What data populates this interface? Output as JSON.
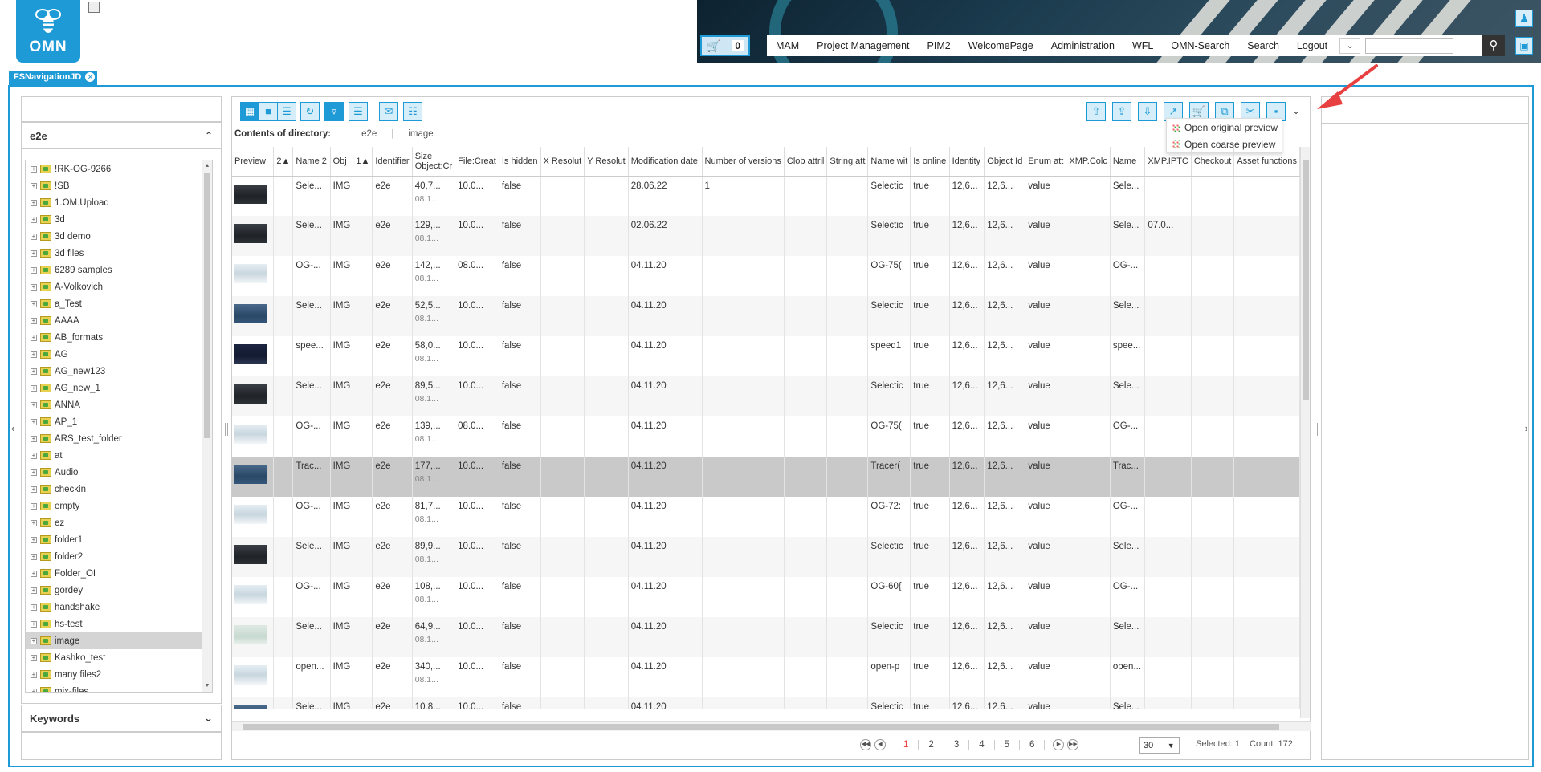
{
  "header": {
    "logo_text": "OMN",
    "cart_count": "0",
    "menu": [
      "MAM",
      "Project Management",
      "PIM2",
      "WelcomePage",
      "Administration",
      "WFL",
      "OMN-Search",
      "Search",
      "Logout"
    ],
    "search_placeholder": ""
  },
  "tab": {
    "label": "FSNavigationJD"
  },
  "left_panel": {
    "title": "e2e",
    "keywords_title": "Keywords",
    "tree": [
      "!RK-OG-9266",
      "!SB",
      "1.OM.Upload",
      "3d",
      "3d demo",
      "3d files",
      "6289 samples",
      "A-Volkovich",
      "a_Test",
      "AAAA",
      "AB_formats",
      "AG",
      "AG_new123",
      "AG_new_1",
      "ANNA",
      "AP_1",
      "ARS_test_folder",
      "at",
      "Audio",
      "checkin",
      "empty",
      "ez",
      "folder1",
      "folder2",
      "Folder_OI",
      "gordey",
      "handshake",
      "hs-test",
      "image",
      "Kashko_test",
      "many files2",
      "mix-files"
    ],
    "selected": "image"
  },
  "main": {
    "dir_label": "Contents of directory:",
    "breadcrumb": [
      "e2e",
      "image"
    ],
    "dropdown": [
      "Open original preview",
      "Open coarse preview"
    ],
    "columns": [
      "Preview",
      "2▲",
      "Name 2",
      "Obj",
      "1▲",
      "Identifier",
      "Size Object:Cr",
      "File:Creat",
      "Is hidden",
      "X Resolut",
      "Y Resolut",
      "Modification date",
      "Number of versions",
      "Clob attril",
      "String att",
      "Name wit",
      "Is online",
      "Identity",
      "Object Id",
      "Enum att",
      "XMP.Colc",
      "Name",
      "XMP.IPTC",
      "Checkout",
      "Asset functions"
    ],
    "rows": [
      {
        "name2": "Sele...",
        "obj": "IMG",
        "ident": "e2e",
        "size": "40,7...",
        "size2": "08.1...",
        "fcreat": "10.0...",
        "hidden": "false",
        "moddate": "28.06.22",
        "versions": "1",
        "namewit": "Selectic",
        "online": "true",
        "identity": "12,6...",
        "objid": "12,6...",
        "enum": "value",
        "name": "Sele...",
        "iptc": "",
        "thumb": "dark"
      },
      {
        "name2": "Sele...",
        "obj": "IMG",
        "ident": "e2e",
        "size": "129,...",
        "size2": "08.1...",
        "fcreat": "10.0...",
        "hidden": "false",
        "moddate": "02.06.22",
        "versions": "",
        "namewit": "Selectic",
        "online": "true",
        "identity": "12,6...",
        "objid": "12,6...",
        "enum": "value",
        "name": "Sele...",
        "iptc": "07.0...",
        "thumb": "dark"
      },
      {
        "name2": "OG-...",
        "obj": "IMG",
        "ident": "e2e",
        "size": "142,...",
        "size2": "08.1...",
        "fcreat": "08.0...",
        "hidden": "false",
        "moddate": "04.11.20",
        "versions": "",
        "namewit": "OG-75(",
        "online": "true",
        "identity": "12,6...",
        "objid": "12,6...",
        "enum": "value",
        "name": "OG-...",
        "iptc": "",
        "thumb": "light"
      },
      {
        "name2": "Sele...",
        "obj": "IMG",
        "ident": "e2e",
        "size": "52,5...",
        "size2": "08.1...",
        "fcreat": "10.0...",
        "hidden": "false",
        "moddate": "04.11.20",
        "versions": "",
        "namewit": "Selectic",
        "online": "true",
        "identity": "12,6...",
        "objid": "12,6...",
        "enum": "value",
        "name": "Sele...",
        "iptc": "",
        "thumb": "blue"
      },
      {
        "name2": "spee...",
        "obj": "IMG",
        "ident": "e2e",
        "size": "58,0...",
        "size2": "08.1...",
        "fcreat": "10.0...",
        "hidden": "false",
        "moddate": "04.11.20",
        "versions": "",
        "namewit": "speed1",
        "online": "true",
        "identity": "12,6...",
        "objid": "12,6...",
        "enum": "value",
        "name": "spee...",
        "iptc": "",
        "thumb": "navy"
      },
      {
        "name2": "Sele...",
        "obj": "IMG",
        "ident": "e2e",
        "size": "89,5...",
        "size2": "08.1...",
        "fcreat": "10.0...",
        "hidden": "false",
        "moddate": "04.11.20",
        "versions": "",
        "namewit": "Selectic",
        "online": "true",
        "identity": "12,6...",
        "objid": "12,6...",
        "enum": "value",
        "name": "Sele...",
        "iptc": "",
        "thumb": "dark"
      },
      {
        "name2": "OG-...",
        "obj": "IMG",
        "ident": "e2e",
        "size": "139,...",
        "size2": "08.1...",
        "fcreat": "08.0...",
        "hidden": "false",
        "moddate": "04.11.20",
        "versions": "",
        "namewit": "OG-75(",
        "online": "true",
        "identity": "12,6...",
        "objid": "12,6...",
        "enum": "value",
        "name": "OG-...",
        "iptc": "",
        "thumb": "light"
      },
      {
        "name2": "Trac...",
        "obj": "IMG",
        "ident": "e2e",
        "size": "177,...",
        "size2": "08.1...",
        "fcreat": "10.0...",
        "hidden": "false",
        "moddate": "04.11.20",
        "versions": "",
        "namewit": "Tracer(",
        "online": "true",
        "identity": "12,6...",
        "objid": "12,6...",
        "enum": "value",
        "name": "Trac...",
        "iptc": "",
        "thumb": "blue",
        "selected": true
      },
      {
        "name2": "OG-...",
        "obj": "IMG",
        "ident": "e2e",
        "size": "81,7...",
        "size2": "08.1...",
        "fcreat": "10.0...",
        "hidden": "false",
        "moddate": "04.11.20",
        "versions": "",
        "namewit": "OG-72:",
        "online": "true",
        "identity": "12,6...",
        "objid": "12,6...",
        "enum": "value",
        "name": "OG-...",
        "iptc": "",
        "thumb": "light"
      },
      {
        "name2": "Sele...",
        "obj": "IMG",
        "ident": "e2e",
        "size": "89,9...",
        "size2": "08.1...",
        "fcreat": "10.0...",
        "hidden": "false",
        "moddate": "04.11.20",
        "versions": "",
        "namewit": "Selectic",
        "online": "true",
        "identity": "12,6...",
        "objid": "12,6...",
        "enum": "value",
        "name": "Sele...",
        "iptc": "",
        "thumb": "dark"
      },
      {
        "name2": "OG-...",
        "obj": "IMG",
        "ident": "e2e",
        "size": "108,...",
        "size2": "08.1...",
        "fcreat": "10.0...",
        "hidden": "false",
        "moddate": "04.11.20",
        "versions": "",
        "namewit": "OG-60{",
        "online": "true",
        "identity": "12,6...",
        "objid": "12,6...",
        "enum": "value",
        "name": "OG-...",
        "iptc": "",
        "thumb": "light"
      },
      {
        "name2": "Sele...",
        "obj": "IMG",
        "ident": "e2e",
        "size": "64,9...",
        "size2": "08.1...",
        "fcreat": "10.0...",
        "hidden": "false",
        "moddate": "04.11.20",
        "versions": "",
        "namewit": "Selectic",
        "online": "true",
        "identity": "12,6...",
        "objid": "12,6...",
        "enum": "value",
        "name": "Sele...",
        "iptc": "",
        "thumb": "pale"
      },
      {
        "name2": "open...",
        "obj": "IMG",
        "ident": "e2e",
        "size": "340,...",
        "size2": "08.1...",
        "fcreat": "10.0...",
        "hidden": "false",
        "moddate": "04.11.20",
        "versions": "",
        "namewit": "open-p",
        "online": "true",
        "identity": "12,6...",
        "objid": "12,6...",
        "enum": "value",
        "name": "open...",
        "iptc": "",
        "thumb": "light"
      },
      {
        "name2": "Sele...",
        "obj": "IMG",
        "ident": "e2e",
        "size": "10,8...",
        "size2": "",
        "fcreat": "10.0...",
        "hidden": "false",
        "moddate": "04.11.20",
        "versions": "",
        "namewit": "Selectic",
        "online": "true",
        "identity": "12,6...",
        "objid": "12,6...",
        "enum": "value",
        "name": "Sele...",
        "iptc": "",
        "thumb": "blue"
      }
    ],
    "pages": [
      "1",
      "2",
      "3",
      "4",
      "5",
      "6"
    ],
    "current_page": "1",
    "page_size": "30",
    "selected_label": "Selected: 1",
    "count_label": "Count: 172"
  },
  "colors": {
    "accent": "#1e9ad6",
    "selected_row": "#c9c9c9",
    "current_page": "#e33333",
    "arrow": "#e84040"
  }
}
